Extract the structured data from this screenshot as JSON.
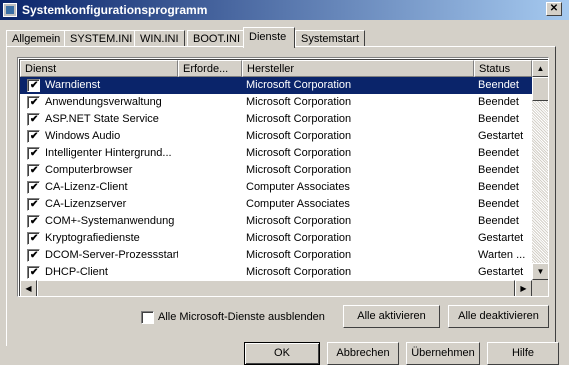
{
  "window": {
    "title": "Systemkonfigurationsprogramm",
    "close_glyph": "✕"
  },
  "tabs": [
    {
      "label": "Allgemein"
    },
    {
      "label": "SYSTEM.INI"
    },
    {
      "label": "WIN.INI"
    },
    {
      "label": "BOOT.INI"
    },
    {
      "label": "Dienste"
    },
    {
      "label": "Systemstart"
    }
  ],
  "active_tab": "Dienste",
  "columns": {
    "name": "Dienst",
    "required": "Erforde...",
    "manufacturer": "Hersteller",
    "status": "Status"
  },
  "services": [
    {
      "name": "Warndienst",
      "manufacturer": "Microsoft Corporation",
      "status": "Beendet",
      "checked": true,
      "selected": true
    },
    {
      "name": "Anwendungsverwaltung",
      "manufacturer": "Microsoft Corporation",
      "status": "Beendet",
      "checked": true
    },
    {
      "name": "ASP.NET State Service",
      "manufacturer": "Microsoft Corporation",
      "status": "Beendet",
      "checked": true
    },
    {
      "name": "Windows Audio",
      "manufacturer": "Microsoft Corporation",
      "status": "Gestartet",
      "checked": true
    },
    {
      "name": "Intelligenter Hintergrund...",
      "manufacturer": "Microsoft Corporation",
      "status": "Beendet",
      "checked": true
    },
    {
      "name": "Computerbrowser",
      "manufacturer": "Microsoft Corporation",
      "status": "Beendet",
      "checked": true
    },
    {
      "name": "CA-Lizenz-Client",
      "manufacturer": "Computer Associates",
      "status": "Beendet",
      "checked": true
    },
    {
      "name": "CA-Lizenzserver",
      "manufacturer": "Computer Associates",
      "status": "Beendet",
      "checked": true
    },
    {
      "name": "COM+-Systemanwendung",
      "manufacturer": "Microsoft Corporation",
      "status": "Beendet",
      "checked": true
    },
    {
      "name": "Kryptografiedienste",
      "manufacturer": "Microsoft Corporation",
      "status": "Gestartet",
      "checked": true
    },
    {
      "name": "DCOM-Server-Prozessstart",
      "manufacturer": "Microsoft Corporation",
      "status": "Warten ...",
      "checked": true
    },
    {
      "name": "DHCP-Client",
      "manufacturer": "Microsoft Corporation",
      "status": "Gestartet",
      "checked": true
    }
  ],
  "hide_ms_services": {
    "label": "Alle Microsoft-Dienste ausblenden",
    "checked": false
  },
  "buttons": {
    "enable_all": "Alle aktivieren",
    "disable_all": "Alle deaktivieren",
    "ok": "OK",
    "cancel": "Abbrechen",
    "apply": "Übernehmen",
    "help": "Hilfe"
  },
  "icons": {
    "check": "✔",
    "up": "▲",
    "down": "▼",
    "left": "◀",
    "right": "▶"
  },
  "colors": {
    "selection": "#0a246a",
    "face": "#d4d0c8"
  }
}
